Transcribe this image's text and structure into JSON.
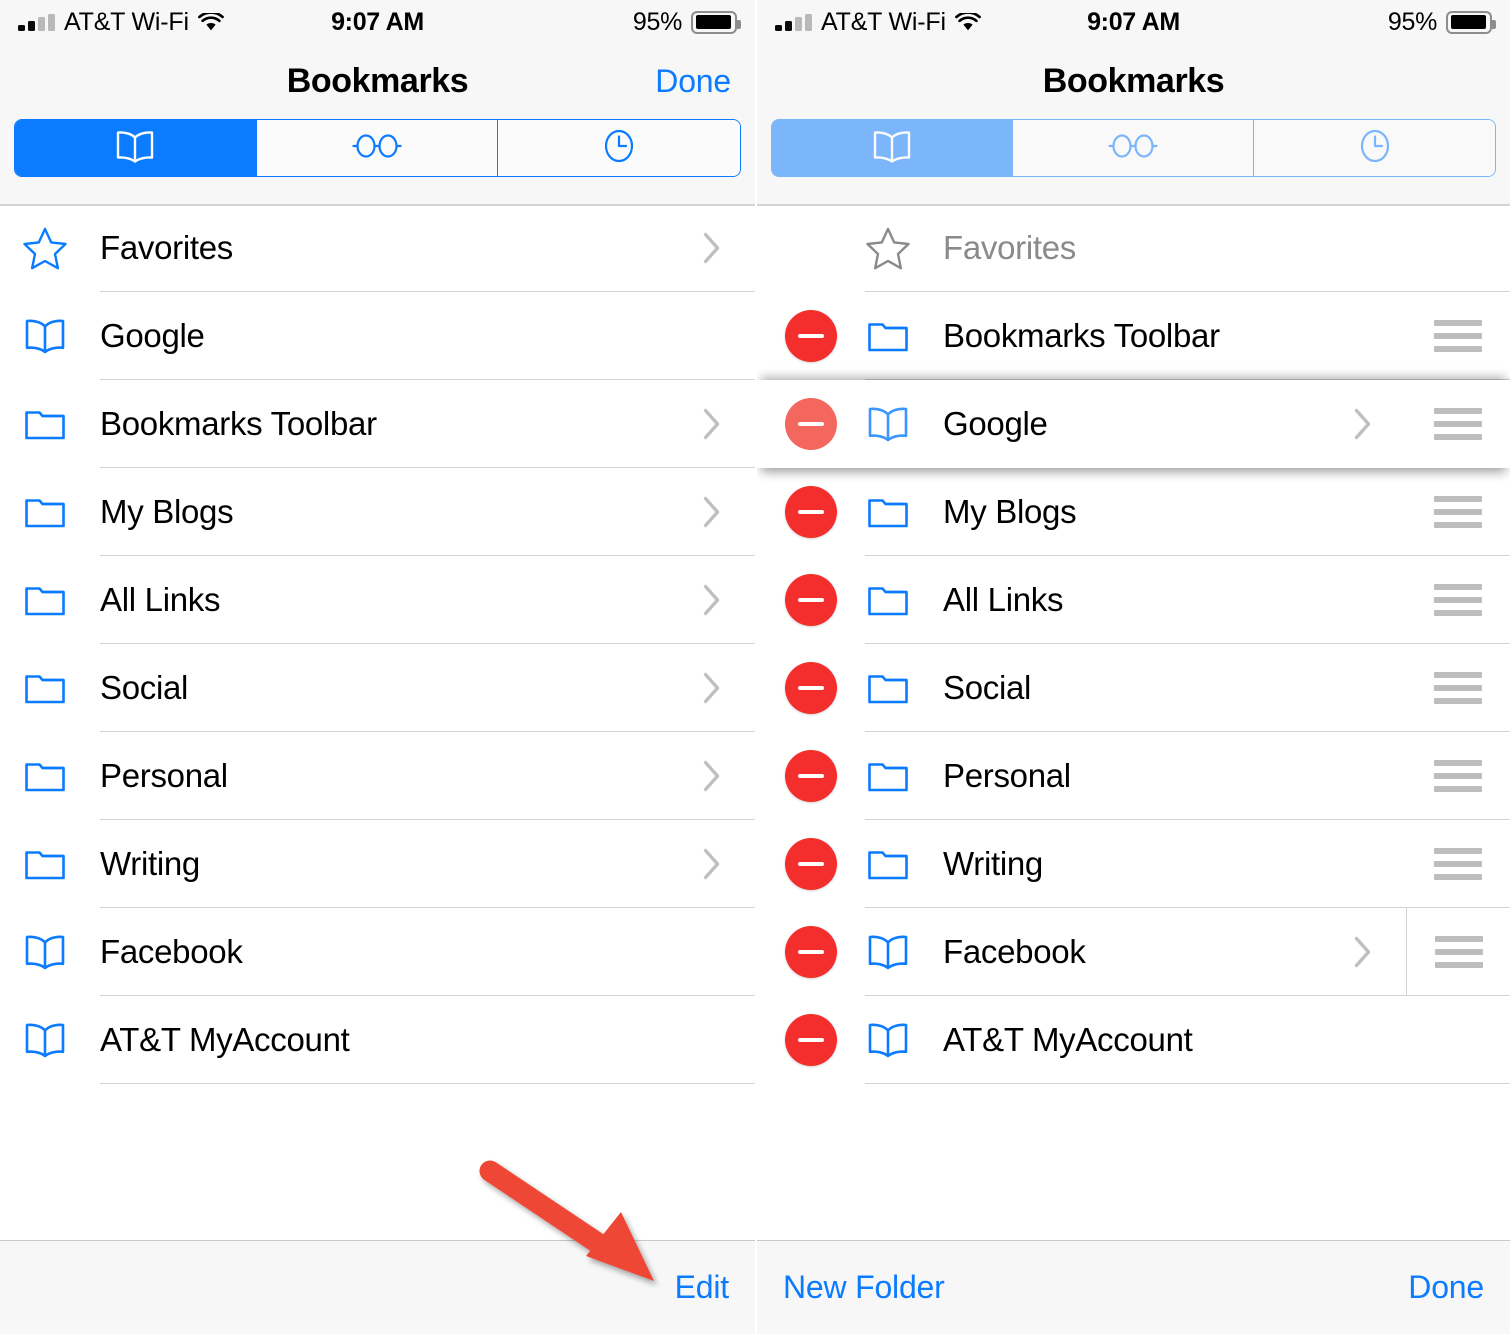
{
  "status_bar": {
    "carrier": "AT&T Wi-Fi",
    "time": "9:07 AM",
    "battery_percent": "95%",
    "signal_icon": "cellular-signal-icon",
    "wifi_icon": "wifi-icon",
    "battery_icon": "battery-icon"
  },
  "colors": {
    "accent_blue": "#0b7bff",
    "delete_red": "#f42d2d",
    "delete_red_dragging": "#f4675f",
    "annotation_red": "#ef4734",
    "separator": "#d3d3d3",
    "chrome_bg": "#f7f7f7",
    "dim_text": "#8a8a8a"
  },
  "left_panel": {
    "nav": {
      "title": "Bookmarks",
      "done_label": "Done"
    },
    "segmented_control": {
      "selected_index": 0,
      "segments": [
        {
          "icon": "book-icon",
          "name": "bookmarks-tab"
        },
        {
          "icon": "reading-glasses-icon",
          "name": "reading-list-tab"
        },
        {
          "icon": "clock-icon",
          "name": "history-tab"
        }
      ]
    },
    "rows": [
      {
        "label": "Favorites",
        "icon": "star-icon",
        "chevron": true
      },
      {
        "label": "Google",
        "icon": "book-icon",
        "chevron": false
      },
      {
        "label": "Bookmarks Toolbar",
        "icon": "folder-icon",
        "chevron": true
      },
      {
        "label": "My Blogs",
        "icon": "folder-icon",
        "chevron": true
      },
      {
        "label": "All Links",
        "icon": "folder-icon",
        "chevron": true
      },
      {
        "label": "Social",
        "icon": "folder-icon",
        "chevron": true
      },
      {
        "label": "Personal",
        "icon": "folder-icon",
        "chevron": true
      },
      {
        "label": "Writing",
        "icon": "folder-icon",
        "chevron": true
      },
      {
        "label": "Facebook",
        "icon": "book-icon",
        "chevron": false
      },
      {
        "label": "AT&T MyAccount",
        "icon": "book-icon",
        "chevron": false
      }
    ],
    "toolbar": {
      "edit_label": "Edit"
    },
    "annotation": {
      "type": "arrow",
      "points_to": "Edit"
    }
  },
  "right_panel": {
    "nav": {
      "title": "Bookmarks"
    },
    "segmented_control": {
      "selected_index": 0,
      "faded": true,
      "segments": [
        {
          "icon": "book-icon",
          "name": "bookmarks-tab"
        },
        {
          "icon": "reading-glasses-icon",
          "name": "reading-list-tab"
        },
        {
          "icon": "clock-icon",
          "name": "history-tab"
        }
      ]
    },
    "rows": [
      {
        "label": "Favorites",
        "icon": "star-icon",
        "delete": false,
        "handle": false,
        "chevron": false,
        "dim": true,
        "dragging": false,
        "vsep": false
      },
      {
        "label": "Bookmarks Toolbar",
        "icon": "folder-icon",
        "delete": true,
        "handle": true,
        "chevron": false,
        "dim": false,
        "dragging": false,
        "vsep": false
      },
      {
        "label": "Google",
        "icon": "book-icon",
        "delete": true,
        "handle": true,
        "chevron": true,
        "dim": false,
        "dragging": true,
        "vsep": false
      },
      {
        "label": "My Blogs",
        "icon": "folder-icon",
        "delete": true,
        "handle": true,
        "chevron": false,
        "dim": false,
        "dragging": false,
        "vsep": false
      },
      {
        "label": "All Links",
        "icon": "folder-icon",
        "delete": true,
        "handle": true,
        "chevron": false,
        "dim": false,
        "dragging": false,
        "vsep": false
      },
      {
        "label": "Social",
        "icon": "folder-icon",
        "delete": true,
        "handle": true,
        "chevron": false,
        "dim": false,
        "dragging": false,
        "vsep": false
      },
      {
        "label": "Personal",
        "icon": "folder-icon",
        "delete": true,
        "handle": true,
        "chevron": false,
        "dim": false,
        "dragging": false,
        "vsep": false
      },
      {
        "label": "Writing",
        "icon": "folder-icon",
        "delete": true,
        "handle": true,
        "chevron": false,
        "dim": false,
        "dragging": false,
        "vsep": false
      },
      {
        "label": "Facebook",
        "icon": "book-icon",
        "delete": true,
        "handle": true,
        "chevron": true,
        "dim": false,
        "dragging": false,
        "vsep": true
      },
      {
        "label": "AT&T MyAccount",
        "icon": "book-icon",
        "delete": true,
        "handle": false,
        "chevron": false,
        "dim": false,
        "dragging": false,
        "vsep": false
      }
    ],
    "toolbar": {
      "new_folder_label": "New Folder",
      "done_label": "Done"
    }
  }
}
